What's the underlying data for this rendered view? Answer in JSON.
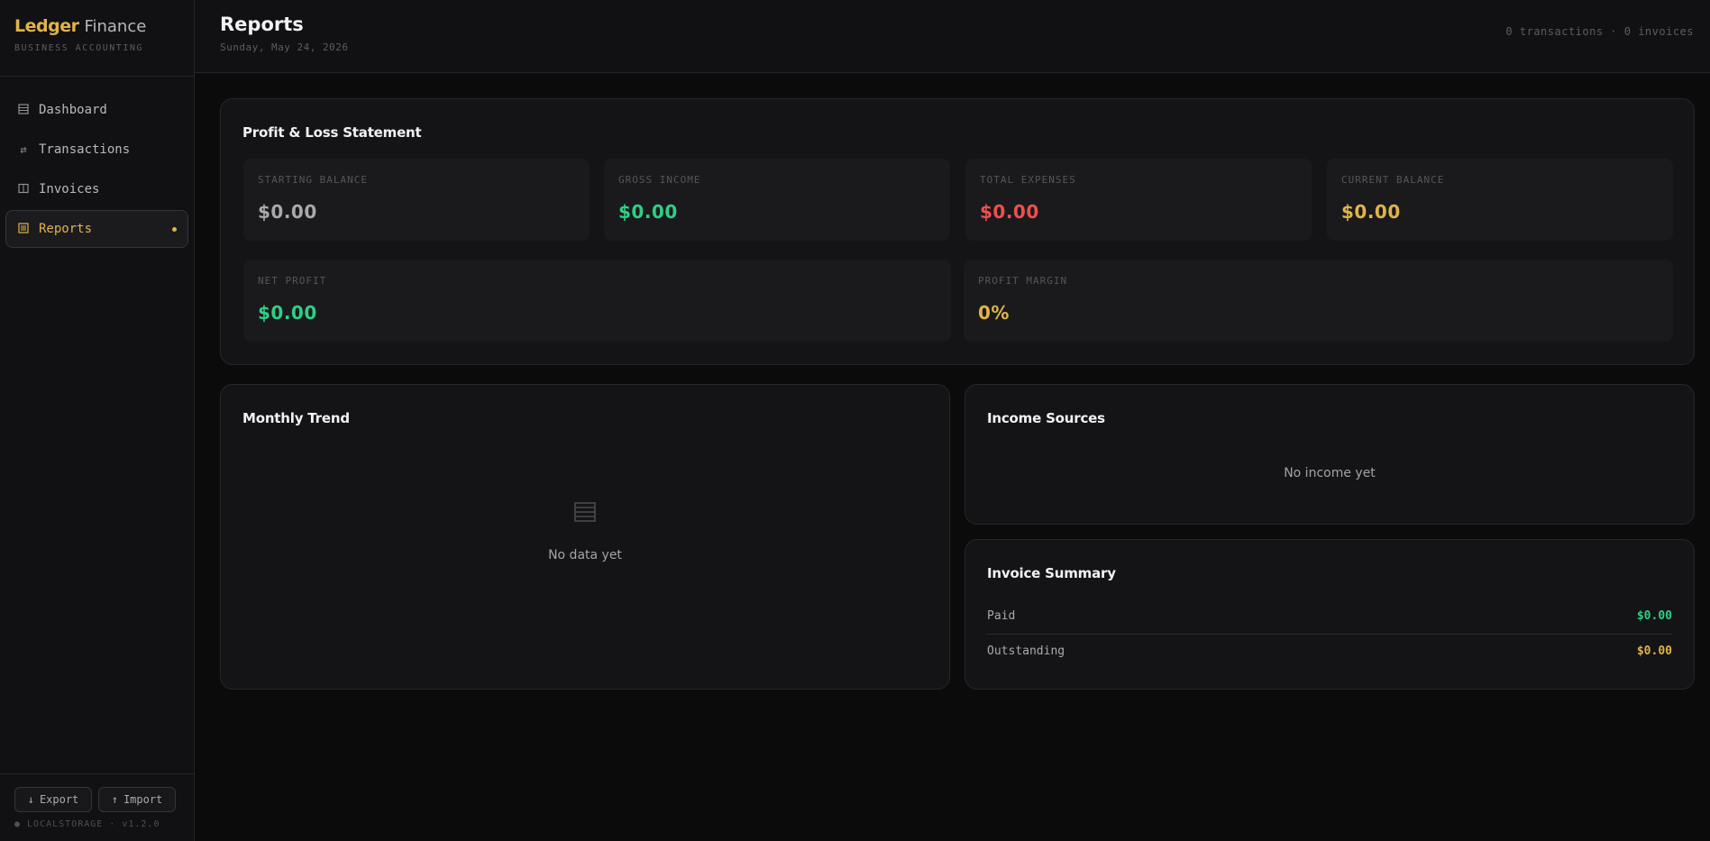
{
  "brand": {
    "name": "Ledger",
    "name_suffix": "Finance",
    "tagline": "BUSINESS ACCOUNTING"
  },
  "sidebar": {
    "items": [
      {
        "label": "Dashboard",
        "icon": "dashboard-grid-icon"
      },
      {
        "label": "Transactions",
        "icon": "arrows-exchange-icon"
      },
      {
        "label": "Invoices",
        "icon": "invoice-columns-icon"
      },
      {
        "label": "Reports",
        "icon": "report-list-icon",
        "active": true
      }
    ],
    "export_label": "Export",
    "import_label": "Import",
    "footer_meta": "● LOCALSTORAGE · v1.2.0"
  },
  "header": {
    "title": "Reports",
    "date": "Sunday, May 24, 2026",
    "stats": "0 transactions · 0 invoices"
  },
  "pnl": {
    "title": "Profit & Loss Statement",
    "stats": [
      {
        "label": "STARTING BALANCE",
        "value": "$0.00",
        "color": "#a8a8ae"
      },
      {
        "label": "GROSS INCOME",
        "value": "$0.00",
        "color": "#2fcf83"
      },
      {
        "label": "TOTAL EXPENSES",
        "value": "$0.00",
        "color": "#ef4f4f"
      },
      {
        "label": "CURRENT BALANCE",
        "value": "$0.00",
        "color": "#e0b34a"
      },
      {
        "label": "NET PROFIT",
        "value": "$0.00",
        "color": "#2fcf83"
      },
      {
        "label": "PROFIT MARGIN",
        "value": "0%",
        "color": "#e0b34a"
      }
    ]
  },
  "monthly_trend": {
    "title": "Monthly Trend",
    "empty_text": "No data yet"
  },
  "income_sources": {
    "title": "Income Sources",
    "empty_text": "No income yet"
  },
  "invoice_summary": {
    "title": "Invoice Summary",
    "rows": [
      {
        "label": "Paid",
        "value": "$0.00",
        "color": "#2fcf83"
      },
      {
        "label": "Outstanding",
        "value": "$0.00",
        "color": "#e0b34a"
      }
    ]
  },
  "colors": {
    "accent": "#e0b34a",
    "positive": "#2fcf83",
    "negative": "#ef4f4f"
  }
}
